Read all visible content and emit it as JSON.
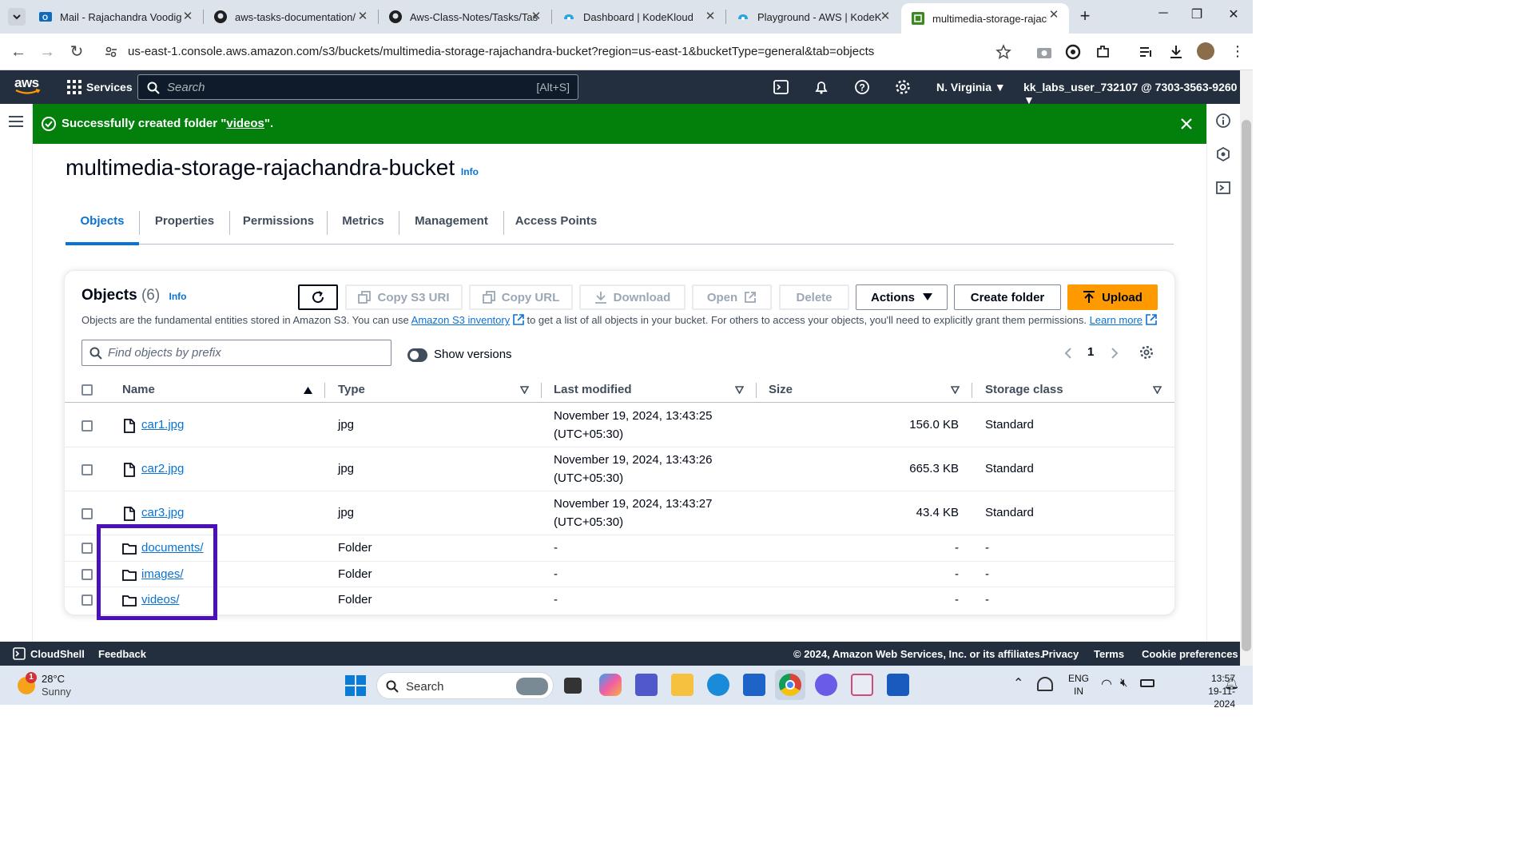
{
  "browser": {
    "tabs": [
      {
        "label": "Mail - Rajachandra Voodig",
        "active": false
      },
      {
        "label": "aws-tasks-documentation/",
        "active": false
      },
      {
        "label": "Aws-Class-Notes/Tasks/Tas",
        "active": false
      },
      {
        "label": "Dashboard | KodeKloud",
        "active": false
      },
      {
        "label": "Playground - AWS | KodeK",
        "active": false
      },
      {
        "label": "multimedia-storage-rajach",
        "active": true
      }
    ],
    "url": "us-east-1.console.aws.amazon.com/s3/buckets/multimedia-storage-rajachandra-bucket?region=us-east-1&bucketType=general&tab=objects"
  },
  "aws_header": {
    "logo": "aws",
    "services_label": "Services",
    "search_placeholder": "Search",
    "search_shortcut": "[Alt+S]",
    "region": "N. Virginia",
    "account": "kk_labs_user_732107 @ 7303-3563-9260"
  },
  "flash": {
    "prefix": "Successfully created folder \"",
    "folder": "videos",
    "suffix": "\".",
    "color": "#037f0c"
  },
  "bucket": {
    "name": "multimedia-storage-rajachandra-bucket",
    "info": "Info"
  },
  "tabs": [
    "Objects",
    "Properties",
    "Permissions",
    "Metrics",
    "Management",
    "Access Points"
  ],
  "objects": {
    "title": "Objects",
    "count": "(6)",
    "info": "Info",
    "desc_before": "Objects are the fundamental entities stored in Amazon S3. You can use ",
    "desc_link": "Amazon S3 inventory",
    "desc_after": " to get a list of all objects in your bucket. For others to access your objects, you'll need to explicitly grant them permissions. ",
    "learn_more": "Learn more",
    "buttons": {
      "refresh": "",
      "copy_s3_uri": "Copy S3 URI",
      "copy_url": "Copy URL",
      "download": "Download",
      "open": "Open",
      "delete": "Delete",
      "actions": "Actions",
      "create_folder": "Create folder",
      "upload": "Upload"
    },
    "filter_placeholder": "Find objects by prefix",
    "show_versions": "Show versions",
    "page": "1",
    "columns": [
      "Name",
      "Type",
      "Last modified",
      "Size",
      "Storage class"
    ],
    "rows": [
      {
        "name": "car1.jpg",
        "kind": "file",
        "type": "jpg",
        "modified_1": "November 19, 2024, 13:43:25",
        "modified_2": "(UTC+05:30)",
        "size": "156.0 KB",
        "storage": "Standard"
      },
      {
        "name": "car2.jpg",
        "kind": "file",
        "type": "jpg",
        "modified_1": "November 19, 2024, 13:43:26",
        "modified_2": "(UTC+05:30)",
        "size": "665.3 KB",
        "storage": "Standard"
      },
      {
        "name": "car3.jpg",
        "kind": "file",
        "type": "jpg",
        "modified_1": "November 19, 2024, 13:43:27",
        "modified_2": "(UTC+05:30)",
        "size": "43.4 KB",
        "storage": "Standard"
      },
      {
        "name": "documents/",
        "kind": "folder",
        "type": "Folder",
        "modified_1": "-",
        "modified_2": "",
        "size": "-",
        "storage": "-"
      },
      {
        "name": "images/",
        "kind": "folder",
        "type": "Folder",
        "modified_1": "-",
        "modified_2": "",
        "size": "-",
        "storage": "-"
      },
      {
        "name": "videos/",
        "kind": "folder",
        "type": "Folder",
        "modified_1": "-",
        "modified_2": "",
        "size": "-",
        "storage": "-"
      }
    ]
  },
  "footer": {
    "cloudshell": "CloudShell",
    "feedback": "Feedback",
    "copyright": "© 2024, Amazon Web Services, Inc. or its affiliates.",
    "privacy": "Privacy",
    "terms": "Terms",
    "cookies": "Cookie preferences"
  },
  "taskbar": {
    "weather_badge": "1",
    "temp": "28°C",
    "condition": "Sunny",
    "search": "Search",
    "lang_1": "ENG",
    "lang_2": "IN",
    "time": "13:57",
    "date": "19-11-2024"
  },
  "colors": {
    "aws_nav": "#232f3e",
    "link": "#0972d3",
    "upload": "#ff9900",
    "highlight": "#4b10b8"
  }
}
